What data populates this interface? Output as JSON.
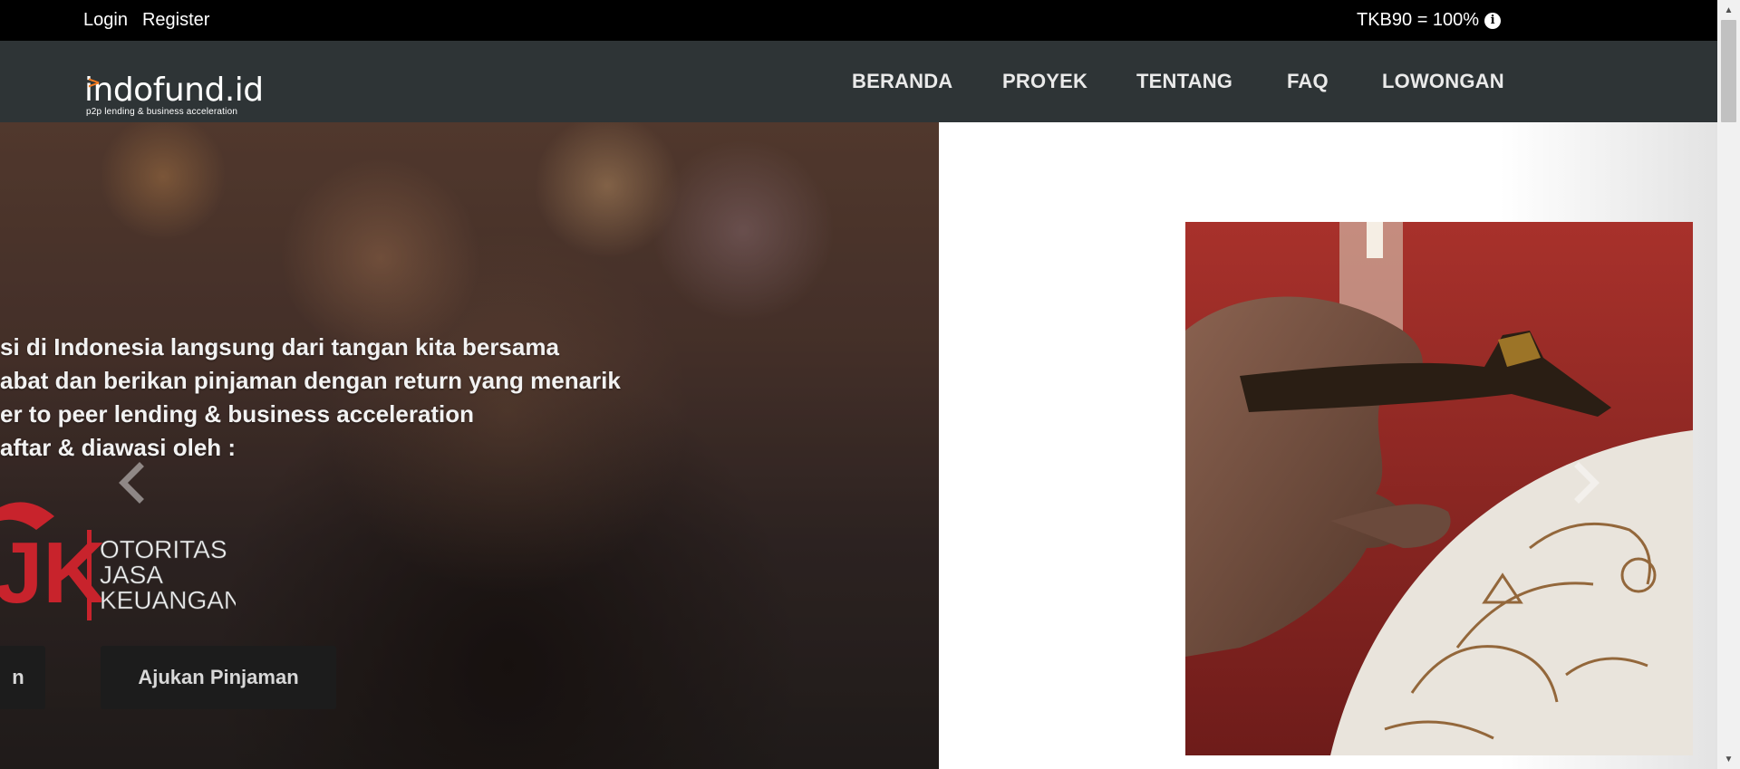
{
  "topbar": {
    "login": "Login",
    "register": "Register",
    "tkb": "TKB90 = 100%",
    "info_icon": "info-circle-icon"
  },
  "logo": {
    "brand": "indofund.id",
    "tagline": "p2p lending & business acceleration",
    "accent_color": "#f47b20"
  },
  "nav": {
    "items": [
      "BERANDA",
      "PROYEK",
      "TENTANG",
      "FAQ",
      "LOWONGAN"
    ]
  },
  "hero": {
    "lines": [
      "si di Indonesia langsung dari tangan kita bersama",
      "abat dan berikan pinjaman dengan return yang menarik",
      "er to peer lending & business acceleration",
      "aftar & diawasi oleh :"
    ],
    "ojk_text": [
      "OTORITAS",
      "JASA",
      "KEUANGAN"
    ],
    "ojk_letters": "JK",
    "buttons": {
      "partial": "n",
      "loan": "Ajukan Pinjaman"
    },
    "prev_icon": "chevron-left-icon",
    "next_icon": "chevron-right-icon"
  },
  "colors": {
    "topbar": "#000000",
    "navbar": "#2e3436",
    "ojk_red": "#c8232c"
  }
}
